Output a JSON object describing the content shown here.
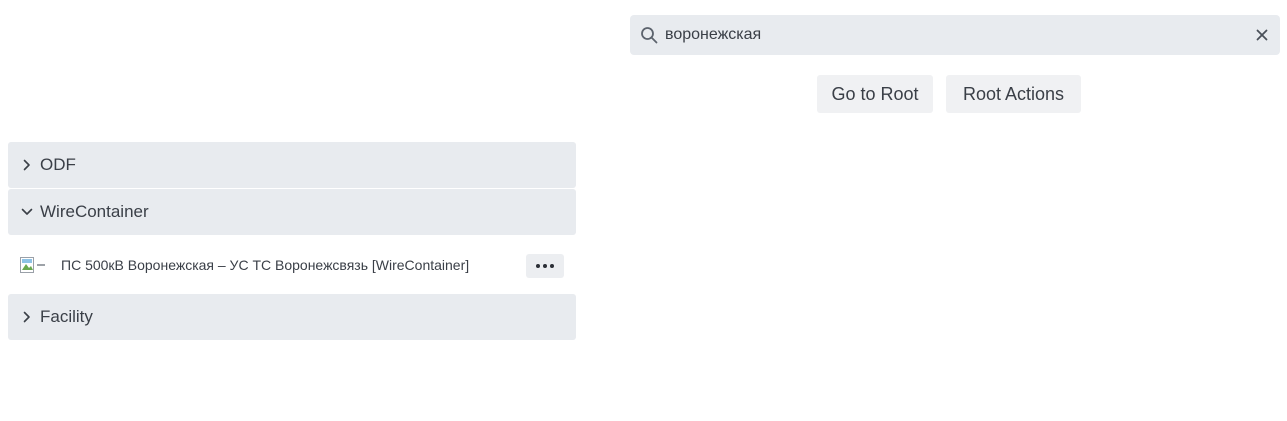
{
  "search": {
    "value": "воронежская",
    "icon": "search-icon",
    "clear_icon": "close-icon"
  },
  "toolbar": {
    "go_to_root_label": "Go to Root",
    "root_actions_label": "Root Actions"
  },
  "tree": {
    "sections": [
      {
        "label": "ODF",
        "expanded": false
      },
      {
        "label": "WireContainer",
        "expanded": true
      },
      {
        "label": "Facility",
        "expanded": false
      }
    ],
    "wirecontainer_items": [
      {
        "label": "ПС 500кВ Воронежская – УС ТС Воронежсвязь [WireContainer]",
        "more_icon": "more-horizontal-icon"
      }
    ]
  },
  "colors": {
    "header_bg": "#e8ebef",
    "button_bg": "#f0f1f3",
    "text": "#3a3f47"
  }
}
